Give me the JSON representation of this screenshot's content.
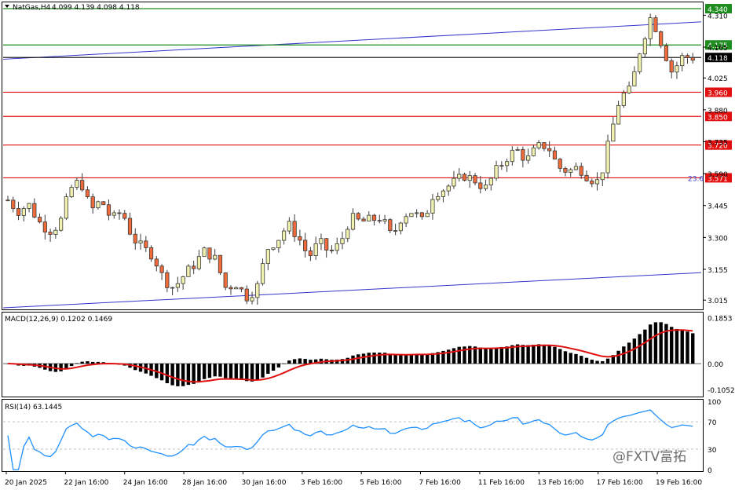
{
  "header": {
    "symbol": "NatGas,H4",
    "ohlc": "4.099 4.139 4.098 4.118",
    "menu_icon": "triangle-down-icon"
  },
  "panels": {
    "macd_label": "MACD(12,26,9) 0.1202 0.1469",
    "rsi_label": "RSI(14) 63.1445"
  },
  "watermark": "@FXTV富拓",
  "fib_label": "23.6",
  "colors": {
    "up_candle": "#f2f2b0",
    "down_candle": "#f06a3a",
    "candle_outline": "#3a3a3a",
    "green_line": "#1e8c1e",
    "red_line": "#e01010",
    "channel_line": "#3333cc",
    "macd_hist": "#000000",
    "macd_signal": "#e01010",
    "rsi_line": "#1e90ff"
  },
  "chart_data": [
    {
      "type": "candlestick",
      "title": "NatGas,H4",
      "y_ticks": [
        "4.310",
        "4.165",
        "4.025",
        "3.880",
        "3.735",
        "3.590",
        "3.445",
        "3.300",
        "3.155",
        "3.015"
      ],
      "ylim": [
        2.98,
        4.365
      ],
      "x_ticks": [
        "20 Jan 2025",
        "22 Jan 16:00",
        "24 Jan 16:00",
        "28 Jan 16:00",
        "30 Jan 16:00",
        "3 Feb 16:00",
        "5 Feb 16:00",
        "7 Feb 16:00",
        "11 Feb 16:00",
        "13 Feb 16:00",
        "17 Feb 16:00",
        "19 Feb 16:00"
      ],
      "close_path": [
        3.47,
        3.42,
        3.45,
        3.37,
        3.33,
        3.36,
        3.52,
        3.56,
        3.42,
        3.47,
        3.38,
        3.42,
        3.3,
        3.25,
        3.22,
        3.11,
        3.07,
        3.13,
        3.18,
        3.24,
        3.2,
        3.07,
        3.09,
        3.03,
        3.07,
        3.25,
        3.29,
        3.36,
        3.3,
        3.21,
        3.28,
        3.23,
        3.27,
        3.39,
        3.37,
        3.38,
        3.39,
        3.3,
        3.4,
        3.42,
        3.37,
        3.5,
        3.52,
        3.55,
        3.58,
        3.56,
        3.52,
        3.6,
        3.66,
        3.7,
        3.65,
        3.71,
        3.72,
        3.62,
        3.6,
        3.62,
        3.57,
        3.55,
        3.75,
        3.94,
        3.97,
        4.17,
        4.31,
        4.18,
        4.05,
        4.12,
        4.118
      ],
      "horizontal_levels": [
        {
          "label": "4.340",
          "value": 4.34,
          "color": "green"
        },
        {
          "label": "4.175",
          "value": 4.175,
          "color": "green"
        },
        {
          "label": "4.118",
          "value": 4.118,
          "color": "black"
        },
        {
          "label": "3.960",
          "value": 3.96,
          "color": "red"
        },
        {
          "label": "3.850",
          "value": 3.85,
          "color": "red"
        },
        {
          "label": "3.720",
          "value": 3.72,
          "color": "red"
        },
        {
          "label": "3.571",
          "value": 3.571,
          "color": "red"
        }
      ],
      "channel_lines": [
        {
          "y_start": 4.11,
          "y_end": 4.28
        },
        {
          "y_start": 2.98,
          "y_end": 3.14
        }
      ]
    },
    {
      "type": "bar",
      "title": "MACD(12,26,9) 0.1202 0.1469",
      "y_ticks": [
        "0.1853",
        "0.00",
        "-0.1052"
      ],
      "ylim": [
        -0.13,
        0.2
      ],
      "macd_value": 0.1202,
      "signal_value": 0.1469
    },
    {
      "type": "line",
      "title": "RSI(14) 63.1445",
      "y_ticks": [
        "100",
        "70",
        "30",
        "0"
      ],
      "ylim": [
        0,
        100
      ],
      "rsi_value": 63.1445
    }
  ]
}
